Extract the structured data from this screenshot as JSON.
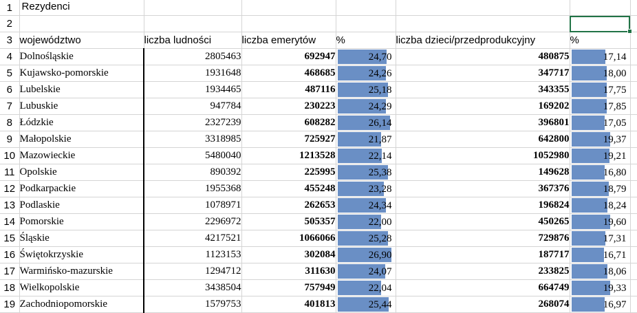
{
  "sheet": {
    "title": "Rezydenci",
    "headers": {
      "region": "województwo",
      "population": "liczba ludności",
      "retirees": "liczba emerytów",
      "retirees_pct": "%",
      "children": "liczba dzieci/przedprodukcyjny",
      "children_pct": "%"
    },
    "row_numbers": [
      "1",
      "2",
      "3",
      "4",
      "5",
      "6",
      "7",
      "8",
      "9",
      "10",
      "11",
      "12",
      "13",
      "14",
      "15",
      "16",
      "17",
      "18",
      "19"
    ],
    "active_row": "2",
    "selected_cell": "F2",
    "data_bar_color": "#6a8fc5",
    "selection_color": "#217346",
    "rows": [
      {
        "region": "Dolnośląskie",
        "population": "2805463",
        "retirees": "692947",
        "retirees_pct": "24,70",
        "retirees_pct_value": 24.7,
        "children": "480875",
        "children_pct": "17,14",
        "children_pct_value": 17.14
      },
      {
        "region": "Kujawsko-pomorskie",
        "population": "1931648",
        "retirees": "468685",
        "retirees_pct": "24,26",
        "retirees_pct_value": 24.26,
        "children": "347717",
        "children_pct": "18,00",
        "children_pct_value": 18.0
      },
      {
        "region": "Lubelskie",
        "population": "1934465",
        "retirees": "487116",
        "retirees_pct": "25,18",
        "retirees_pct_value": 25.18,
        "children": "343355",
        "children_pct": "17,75",
        "children_pct_value": 17.75
      },
      {
        "region": "Lubuskie",
        "population": "947784",
        "retirees": "230223",
        "retirees_pct": "24,29",
        "retirees_pct_value": 24.29,
        "children": "169202",
        "children_pct": "17,85",
        "children_pct_value": 17.85
      },
      {
        "region": "Łódzkie",
        "population": "2327239",
        "retirees": "608282",
        "retirees_pct": "26,14",
        "retirees_pct_value": 26.14,
        "children": "396801",
        "children_pct": "17,05",
        "children_pct_value": 17.05
      },
      {
        "region": "Małopolskie",
        "population": "3318985",
        "retirees": "725927",
        "retirees_pct": "21,87",
        "retirees_pct_value": 21.87,
        "children": "642800",
        "children_pct": "19,37",
        "children_pct_value": 19.37
      },
      {
        "region": "Mazowieckie",
        "population": "5480040",
        "retirees": "1213528",
        "retirees_pct": "22,14",
        "retirees_pct_value": 22.14,
        "children": "1052980",
        "children_pct": "19,21",
        "children_pct_value": 19.21
      },
      {
        "region": "Opolskie",
        "population": "890392",
        "retirees": "225995",
        "retirees_pct": "25,38",
        "retirees_pct_value": 25.38,
        "children": "149628",
        "children_pct": "16,80",
        "children_pct_value": 16.8
      },
      {
        "region": "Podkarpackie",
        "population": "1955368",
        "retirees": "455248",
        "retirees_pct": "23,28",
        "retirees_pct_value": 23.28,
        "children": "367376",
        "children_pct": "18,79",
        "children_pct_value": 18.79
      },
      {
        "region": "Podlaskie",
        "population": "1078971",
        "retirees": "262653",
        "retirees_pct": "24,34",
        "retirees_pct_value": 24.34,
        "children": "196824",
        "children_pct": "18,24",
        "children_pct_value": 18.24
      },
      {
        "region": "Pomorskie",
        "population": "2296972",
        "retirees": "505357",
        "retirees_pct": "22,00",
        "retirees_pct_value": 22.0,
        "children": "450265",
        "children_pct": "19,60",
        "children_pct_value": 19.6
      },
      {
        "region": "Śląskie",
        "population": "4217521",
        "retirees": "1066066",
        "retirees_pct": "25,28",
        "retirees_pct_value": 25.28,
        "children": "729876",
        "children_pct": "17,31",
        "children_pct_value": 17.31
      },
      {
        "region": "Świętokrzyskie",
        "population": "1123153",
        "retirees": "302084",
        "retirees_pct": "26,90",
        "retirees_pct_value": 26.9,
        "children": "187717",
        "children_pct": "16,71",
        "children_pct_value": 16.71
      },
      {
        "region": "Warmińsko-mazurskie",
        "population": "1294712",
        "retirees": "311630",
        "retirees_pct": "24,07",
        "retirees_pct_value": 24.07,
        "children": "233825",
        "children_pct": "18,06",
        "children_pct_value": 18.06
      },
      {
        "region": "Wielkopolskie",
        "population": "3438504",
        "retirees": "757949",
        "retirees_pct": "22,04",
        "retirees_pct_value": 22.04,
        "children": "664749",
        "children_pct": "19,33",
        "children_pct_value": 19.33
      },
      {
        "region": "Zachodniopomorskie",
        "population": "1579753",
        "retirees": "401813",
        "retirees_pct": "25,44",
        "retirees_pct_value": 25.44,
        "children": "268074",
        "children_pct": "16,97",
        "children_pct_value": 16.97
      }
    ]
  }
}
